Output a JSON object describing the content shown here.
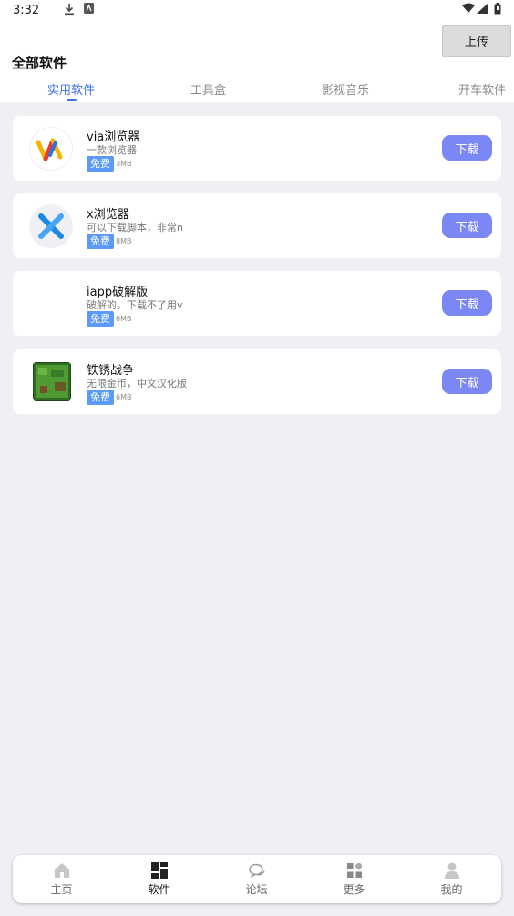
{
  "status_bar": {
    "time": "3:32"
  },
  "header": {
    "title": "全部软件",
    "upload_label": "上传"
  },
  "tabs": [
    {
      "label": "实用软件",
      "active": true
    },
    {
      "label": "工具盒",
      "active": false
    },
    {
      "label": "影视音乐",
      "active": false
    },
    {
      "label": "开车软件",
      "active": false
    }
  ],
  "apps": [
    {
      "name": "via浏览器",
      "desc": "一款浏览器",
      "badge": "免费",
      "size": "3MB",
      "download_label": "下载",
      "icon": "via-browser-icon"
    },
    {
      "name": "x浏览器",
      "desc": "可以下载脚本，非常n",
      "badge": "免费",
      "size": "8MB",
      "download_label": "下载",
      "icon": "x-browser-icon"
    },
    {
      "name": "iapp破解版",
      "desc": "破解的，下载不了用v",
      "badge": "免费",
      "size": "6MB",
      "download_label": "下载",
      "icon": ""
    },
    {
      "name": "铁锈战争",
      "desc": "无限金币，中文汉化版",
      "badge": "免费",
      "size": "6MB",
      "download_label": "下载",
      "icon": "rusted-warfare-icon"
    }
  ],
  "bottom_nav": [
    {
      "label": "主页",
      "icon": "home-icon",
      "active": false
    },
    {
      "label": "软件",
      "icon": "apps-grid-icon",
      "active": true
    },
    {
      "label": "论坛",
      "icon": "chat-icon",
      "active": false
    },
    {
      "label": "更多",
      "icon": "more-grid-icon",
      "active": false
    },
    {
      "label": "我的",
      "icon": "person-icon",
      "active": false
    }
  ],
  "colors": {
    "accent": "#3b6fe6",
    "download_button": "#7b87f5",
    "badge": "#5b9af8",
    "background": "#efeff4"
  }
}
